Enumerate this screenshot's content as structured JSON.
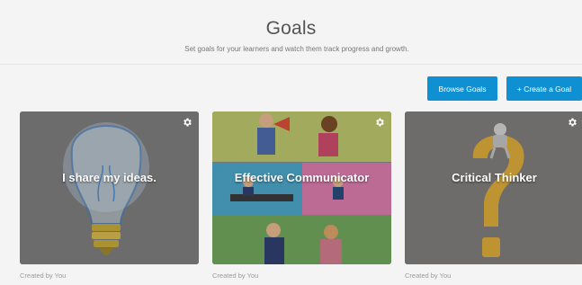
{
  "header": {
    "title": "Goals",
    "subtitle": "Set goals for your learners and watch them track progress and growth."
  },
  "toolbar": {
    "browse_label": "Browse Goals",
    "create_label": "+ Create a Goal"
  },
  "colors": {
    "accent": "#0e90d2",
    "page_background": "#f4f4f4",
    "caption_text": "#9a9a9a"
  },
  "goals": [
    {
      "title": "I share my ideas.",
      "caption": "Created by You",
      "image": "lightbulb",
      "settings_icon": "gear-icon"
    },
    {
      "title": "Effective Communicator",
      "caption": "Created by You",
      "image": "people-collage",
      "settings_icon": "gear-icon"
    },
    {
      "title": "Critical Thinker",
      "caption": "Created by You",
      "image": "question-mark-figure",
      "settings_icon": "gear-icon"
    }
  ]
}
